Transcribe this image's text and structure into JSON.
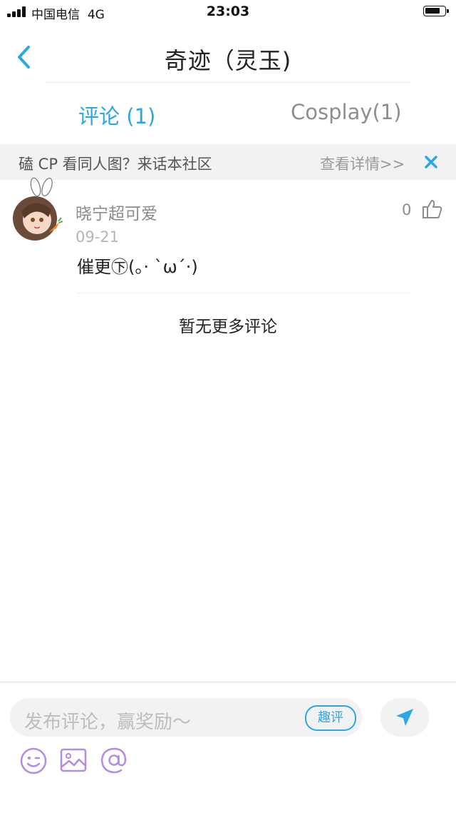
{
  "status_bar": {
    "carrier": "中国电信",
    "network": "4G",
    "time": "23:03"
  },
  "nav": {
    "title": "奇迹（灵玉)",
    "back_icon": "chevron-left-icon"
  },
  "tabs": [
    {
      "label": "评论 (1)",
      "active": true
    },
    {
      "label": "Cosplay(1)",
      "active": false
    }
  ],
  "banner": {
    "text": "磕 CP 看同人图？来话本社区",
    "link": "查看详情>>",
    "close_icon": "close-icon"
  },
  "comments": [
    {
      "username": "晓宁超可爱",
      "date": "09-21",
      "content": "催更㊦(。· `ω´·)",
      "like_count": "0"
    }
  ],
  "footer_note": "暂无更多评论",
  "composer": {
    "placeholder": "发布评论，赢奖励～",
    "qu_ping_label": "趣评",
    "tools": [
      "emoji-icon",
      "image-icon",
      "at-icon"
    ]
  },
  "colors": {
    "accent": "#2ba6e6",
    "tool_purple": "#b38be0"
  }
}
